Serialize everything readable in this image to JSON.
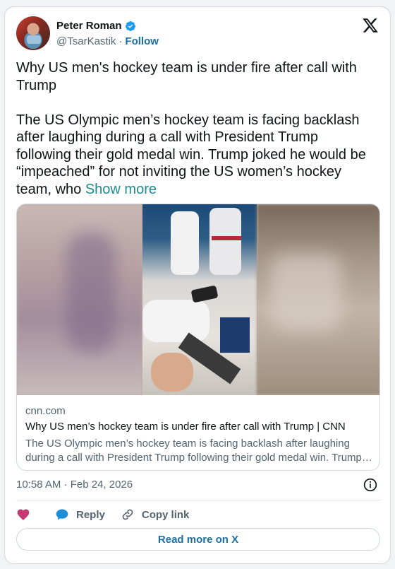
{
  "author": {
    "display_name": "Peter Roman",
    "handle": "@TsarKastik",
    "follow_label": "Follow",
    "separator": "·"
  },
  "tweet": {
    "text": "Why US men's hockey team is under fire after call with Trump\n\nThe US Olympic men’s hockey team is facing backlash after laughing during a call with President Trump following their gold medal win. Trump joked he would be “impeached” for not inviting the US women’s hockey team, who ",
    "show_more_label": "Show more"
  },
  "link_card": {
    "domain": "cnn.com",
    "title": "Why US men’s hockey team is under fire after call with Trump | CNN",
    "description_line1": "The US Olympic men’s hockey team is facing backlash after laughing",
    "description_line2": "during a call with President Trump following their gold medal win. Trump…"
  },
  "timestamp": "10:58 AM · Feb 24, 2026",
  "actions": {
    "reply_label": "Reply",
    "copy_link_label": "Copy link"
  },
  "read_more_label": "Read more on X",
  "colors": {
    "accent": "#1d6fa5",
    "heart": "#c33b73",
    "reply_bubble": "#1d8ed6",
    "verified": "#1d9bf0"
  }
}
